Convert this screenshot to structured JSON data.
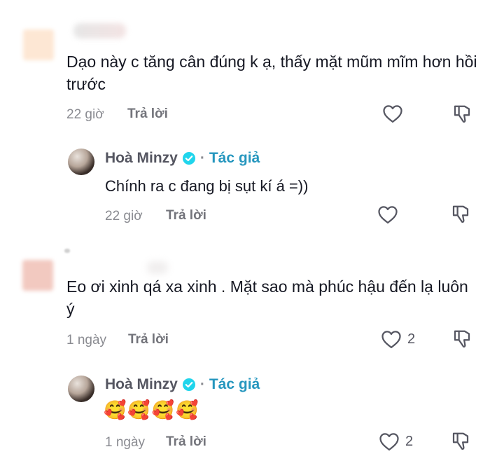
{
  "comment1": {
    "text": "Dạo này c tăng cân đúng k ạ, thấy mặt mũm mĩm hơn hồi trước",
    "time": "22 giờ",
    "reply_label": "Trả lời",
    "avatar_color": "#fde7d4",
    "name_color": "#e3e3e3"
  },
  "reply1": {
    "author": "Hoà Minzy",
    "separator": "·",
    "author_tag": "Tác giả",
    "text": "Chính ra c đang bị sụt kí á =))",
    "time": "22 giờ",
    "reply_label": "Trả lời"
  },
  "comment2": {
    "text": "Eo ơi xinh qá xa xinh . Mặt sao mà phúc hậu đến lạ luôn ý",
    "time": "1 ngày",
    "reply_label": "Trả lời",
    "like_count": "2",
    "avatar_color": "#f2c9c0"
  },
  "reply2": {
    "author": "Hoà Minzy",
    "separator": "·",
    "author_tag": "Tác giả",
    "text": "🥰🥰🥰🥰",
    "time": "1 ngày",
    "reply_label": "Trả lời",
    "like_count": "2"
  },
  "icons": {
    "like": "heart-outline-icon",
    "dislike": "thumbs-down-icon",
    "verified": "verified-badge-icon"
  },
  "colors": {
    "text": "#161823",
    "meta": "#8a8b91",
    "author_tag": "#2596be",
    "verified": "#20d5ec"
  }
}
